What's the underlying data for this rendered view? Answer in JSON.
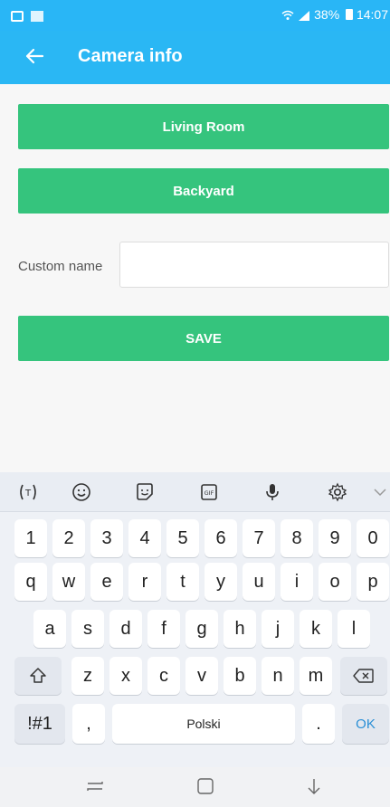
{
  "status_bar": {
    "battery": "38%",
    "time": "14:07",
    "icons": [
      "image-notification-icon",
      "app-notification-icon",
      "wifi-icon",
      "signal-icon",
      "battery-icon"
    ]
  },
  "app_bar": {
    "title": "Camera info",
    "back_icon": "arrow-left-icon"
  },
  "content": {
    "buttons": [
      "Living Room",
      "Backyard"
    ],
    "custom_name_label": "Custom name",
    "custom_name_value": "",
    "save_label": "SAVE"
  },
  "keyboard": {
    "toolbar_icons": [
      "translate-icon",
      "emoji-icon",
      "sticker-icon",
      "gif-icon",
      "mic-icon",
      "settings-icon",
      "collapse-icon"
    ],
    "rows": [
      [
        "1",
        "2",
        "3",
        "4",
        "5",
        "6",
        "7",
        "8",
        "9",
        "0"
      ],
      [
        "q",
        "w",
        "e",
        "r",
        "t",
        "y",
        "u",
        "i",
        "o",
        "p"
      ],
      [
        "a",
        "s",
        "d",
        "f",
        "g",
        "h",
        "j",
        "k",
        "l"
      ],
      [
        "z",
        "x",
        "c",
        "v",
        "b",
        "n",
        "m"
      ]
    ],
    "symbols_key": "!#1",
    "comma_key": ",",
    "space_label": "Polski",
    "period_key": ".",
    "ok_key": "OK"
  },
  "nav_bar": {
    "icons": [
      "recents-icon",
      "home-icon",
      "back-icon"
    ]
  },
  "colors": {
    "status_bar": "#29b6f6",
    "app_bar": "#2ab7f4",
    "button_green": "#35c47d",
    "background": "#f7f7f7"
  }
}
